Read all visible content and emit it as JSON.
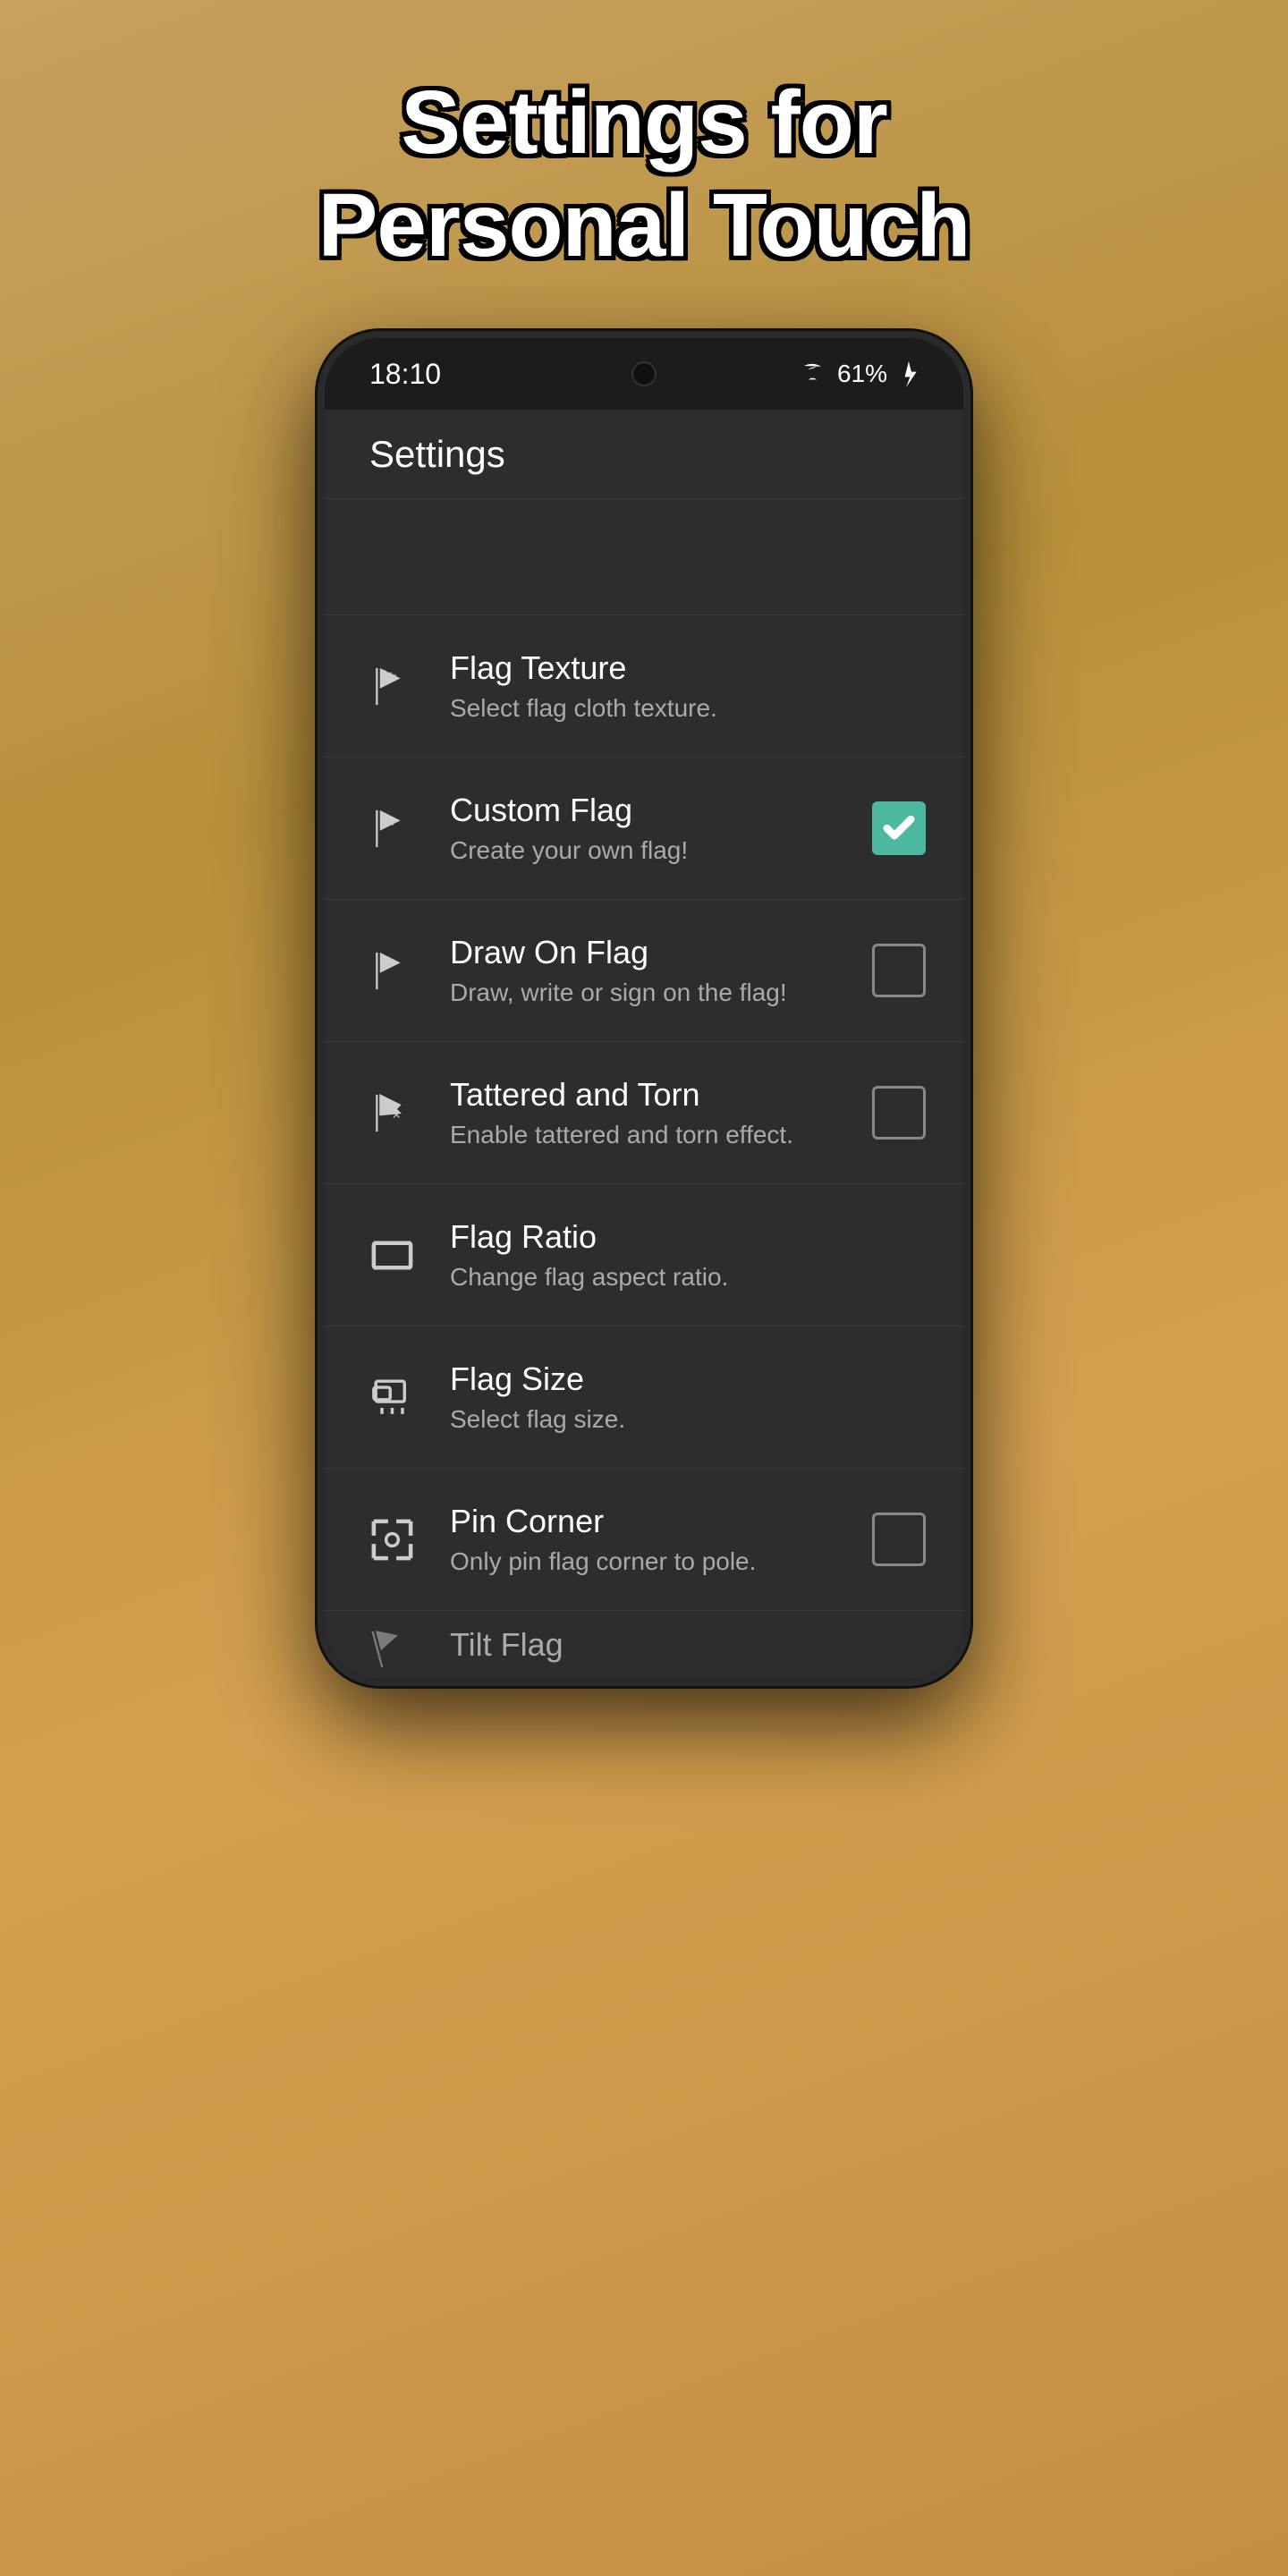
{
  "page": {
    "title_line1": "Settings for",
    "title_line2": "Personal Touch"
  },
  "status_bar": {
    "time": "18:10",
    "battery": "61%",
    "wifi_icon": "wifi-icon",
    "battery_icon": "battery-icon"
  },
  "app_bar": {
    "title": "Settings"
  },
  "settings_items": [
    {
      "id": "flag-texture",
      "title": "Flag Texture",
      "subtitle": "Select flag cloth texture.",
      "has_checkbox": false,
      "checked": false,
      "icon": "flag-texture-icon"
    },
    {
      "id": "custom-flag",
      "title": "Custom Flag",
      "subtitle": "Create your own flag!",
      "has_checkbox": true,
      "checked": true,
      "icon": "custom-flag-icon"
    },
    {
      "id": "draw-on-flag",
      "title": "Draw On Flag",
      "subtitle": "Draw, write or sign on the flag!",
      "has_checkbox": true,
      "checked": false,
      "icon": "draw-flag-icon"
    },
    {
      "id": "tattered-torn",
      "title": "Tattered and Torn",
      "subtitle": "Enable tattered and torn effect.",
      "has_checkbox": true,
      "checked": false,
      "icon": "tattered-flag-icon"
    },
    {
      "id": "flag-ratio",
      "title": "Flag Ratio",
      "subtitle": "Change flag aspect ratio.",
      "has_checkbox": false,
      "checked": false,
      "icon": "ratio-icon"
    },
    {
      "id": "flag-size",
      "title": "Flag Size",
      "subtitle": "Select flag size.",
      "has_checkbox": false,
      "checked": false,
      "icon": "flag-size-icon"
    },
    {
      "id": "pin-corner",
      "title": "Pin Corner",
      "subtitle": "Only pin flag corner to pole.",
      "has_checkbox": true,
      "checked": false,
      "icon": "pin-corner-icon"
    },
    {
      "id": "tilt-flag",
      "title": "Tilt Flag",
      "subtitle": "",
      "has_checkbox": false,
      "checked": false,
      "icon": "tilt-flag-icon",
      "partial": true
    }
  ]
}
